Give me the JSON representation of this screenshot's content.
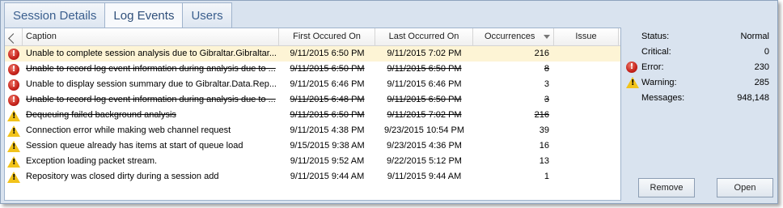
{
  "tabs": [
    {
      "label": "Session Details"
    },
    {
      "label": "Log Events"
    },
    {
      "label": "Users"
    }
  ],
  "grid": {
    "columns": {
      "caption": "Caption",
      "first": "First Occured On",
      "last": "Last Occurred On",
      "occurrences": "Occurrences",
      "issue": "Issue"
    },
    "rows": [
      {
        "severity": "error",
        "caption": "Unable to complete session analysis due to Gibraltar.Gibraltar...",
        "first": "9/11/2015 6:50 PM",
        "last": "9/11/2015 7:02 PM",
        "occurrences": "216",
        "issue": "",
        "struck": false,
        "selected": true
      },
      {
        "severity": "error",
        "caption": "Unable to record log event information during analysis due to ...",
        "first": "9/11/2015 6:50 PM",
        "last": "9/11/2015 6:50 PM",
        "occurrences": "8",
        "issue": "",
        "struck": true,
        "selected": false
      },
      {
        "severity": "error",
        "caption": "Unable to display session summary due to Gibraltar.Data.Rep...",
        "first": "9/11/2015 6:46 PM",
        "last": "9/11/2015 6:46 PM",
        "occurrences": "3",
        "issue": "",
        "struck": false,
        "selected": false
      },
      {
        "severity": "error",
        "caption": "Unable to record log event information during analysis due to ...",
        "first": "9/11/2015 6:48 PM",
        "last": "9/11/2015 6:50 PM",
        "occurrences": "3",
        "issue": "",
        "struck": true,
        "selected": false
      },
      {
        "severity": "warning",
        "caption": "Dequeuing failed background analysis",
        "first": "9/11/2015 6:50 PM",
        "last": "9/11/2015 7:02 PM",
        "occurrences": "216",
        "issue": "",
        "struck": true,
        "selected": false
      },
      {
        "severity": "warning",
        "caption": "Connection error while making web channel request",
        "first": "9/11/2015 4:38 PM",
        "last": "9/23/2015 10:54 PM",
        "occurrences": "39",
        "issue": "",
        "struck": false,
        "selected": false
      },
      {
        "severity": "warning",
        "caption": "Session queue already has items at start of queue load",
        "first": "9/15/2015 9:38 AM",
        "last": "9/23/2015 4:36 PM",
        "occurrences": "16",
        "issue": "",
        "struck": false,
        "selected": false
      },
      {
        "severity": "warning",
        "caption": "Exception loading packet stream.",
        "first": "9/11/2015 9:52 AM",
        "last": "9/22/2015 5:12 PM",
        "occurrences": "13",
        "issue": "",
        "struck": false,
        "selected": false
      },
      {
        "severity": "warning",
        "caption": "Repository was closed dirty during a session add",
        "first": "9/11/2015 9:44 AM",
        "last": "9/11/2015 9:44 AM",
        "occurrences": "1",
        "issue": "",
        "struck": false,
        "selected": false
      }
    ]
  },
  "summary": {
    "status_label": "Status:",
    "status_value": "Normal",
    "critical_label": "Critical:",
    "critical_value": "0",
    "error_label": "Error:",
    "error_value": "230",
    "warning_label": "Warning:",
    "warning_value": "285",
    "messages_label": "Messages:",
    "messages_value": "948,148"
  },
  "buttons": {
    "remove": "Remove",
    "open": "Open"
  },
  "icons": {
    "error": "error-icon",
    "warning": "warning-icon",
    "sort": "sort-descending-icon"
  },
  "colors": {
    "selected_row": "#fdf4d5",
    "error": "#c4211a",
    "warning": "#f2c31a",
    "tab_text": "#3b5f8e",
    "panel_bg": "#d9e3ef"
  }
}
